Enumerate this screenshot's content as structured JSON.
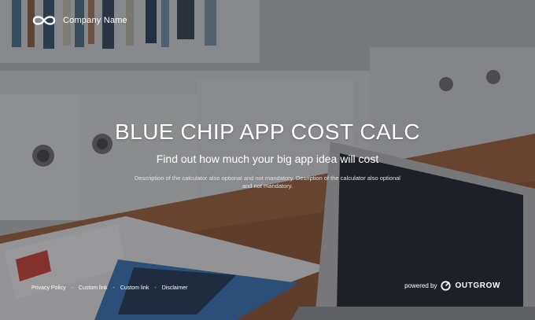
{
  "header": {
    "logo_icon": "infinity-icon",
    "company_name": "Company Name"
  },
  "hero": {
    "title": "BLUE CHIP APP COST CALC",
    "subtitle": "Find out how much your big app idea will cost",
    "description": "Description of the calculator also optional and not mandatory. Desription of the calculator also optional and not mandatory."
  },
  "footer": {
    "links": [
      {
        "label": "Privacy Policy"
      },
      {
        "label": "Custom link"
      },
      {
        "label": "Custom link"
      },
      {
        "label": "Disclaimer"
      }
    ],
    "separator": "-",
    "powered_by": "powered by",
    "brand_icon": "outgrow-logo-icon",
    "brand_name": "OUTGROW"
  },
  "colors": {
    "text": "#ffffff",
    "overlay": "#28282d"
  }
}
